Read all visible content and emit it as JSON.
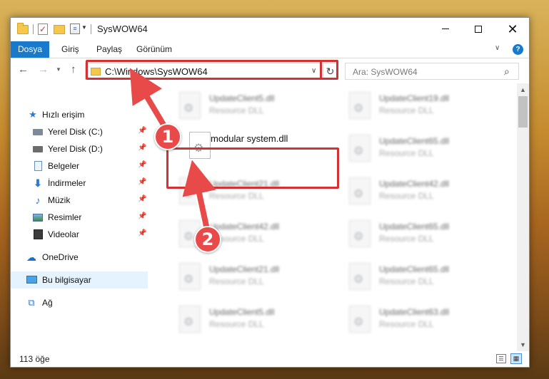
{
  "window": {
    "title": "SysWOW64",
    "minimize_icon": "minimize-icon",
    "maximize_icon": "maximize-icon",
    "close_glyph": "✕"
  },
  "ribbon": {
    "tabs": [
      {
        "label": "Dosya"
      },
      {
        "label": "Giriş"
      },
      {
        "label": "Paylaş"
      },
      {
        "label": "Görünüm"
      }
    ],
    "file_tab_color": "#1979ca",
    "help_label": "?"
  },
  "address": {
    "path": "C:\\Windows\\SysWOW64",
    "refresh_glyph": "↻"
  },
  "search": {
    "placeholder": "Ara: SysWOW64"
  },
  "sidebar": {
    "items": [
      {
        "label": "Hızlı erişim",
        "icon": "star-icon"
      },
      {
        "label": "Yerel Disk (C:)",
        "icon": "drive-icon"
      },
      {
        "label": "Yerel Disk (D:)",
        "icon": "drive-icon"
      },
      {
        "label": "Belgeler",
        "icon": "document-icon"
      },
      {
        "label": "İndirmeler",
        "icon": "download-icon"
      },
      {
        "label": "Müzik",
        "icon": "music-icon"
      },
      {
        "label": "Resimler",
        "icon": "pictures-icon"
      },
      {
        "label": "Videolar",
        "icon": "video-icon"
      },
      {
        "label": "OneDrive",
        "icon": "cloud-icon"
      },
      {
        "label": "Bu bilgisayar",
        "icon": "computer-icon"
      },
      {
        "label": "Ağ",
        "icon": "network-icon"
      }
    ],
    "selected_color": "#cce8ff"
  },
  "files": {
    "left": [
      {
        "name": "UpdateClient5.dll",
        "type": "Resource DLL"
      },
      {
        "name": "modular system.dll",
        "type": ""
      },
      {
        "name": "UpdateClient21.dll",
        "type": "Resource DLL"
      },
      {
        "name": "UpdateClient42.dll",
        "type": "Resource DLL"
      },
      {
        "name": "UpdateClient21.dll",
        "type": "Resource DLL"
      },
      {
        "name": "UpdateClient5.dll",
        "type": "Resource DLL"
      }
    ],
    "right": [
      {
        "name": "UpdateClient19.dll",
        "type": "Resource DLL"
      },
      {
        "name": "UpdateClient65.dll",
        "type": "Resource DLL"
      },
      {
        "name": "UpdateClient42.dll",
        "type": "Resource DLL"
      },
      {
        "name": "UpdateClient65.dll",
        "type": "Resource DLL"
      },
      {
        "name": "UpdateClient65.dll",
        "type": "Resource DLL"
      },
      {
        "name": "UpdateClient63.dll",
        "type": "Resource DLL"
      }
    ]
  },
  "status": {
    "item_count": "113 öğe"
  },
  "annotations": {
    "step1": "1",
    "step2": "2",
    "color": "#e84a4a"
  }
}
